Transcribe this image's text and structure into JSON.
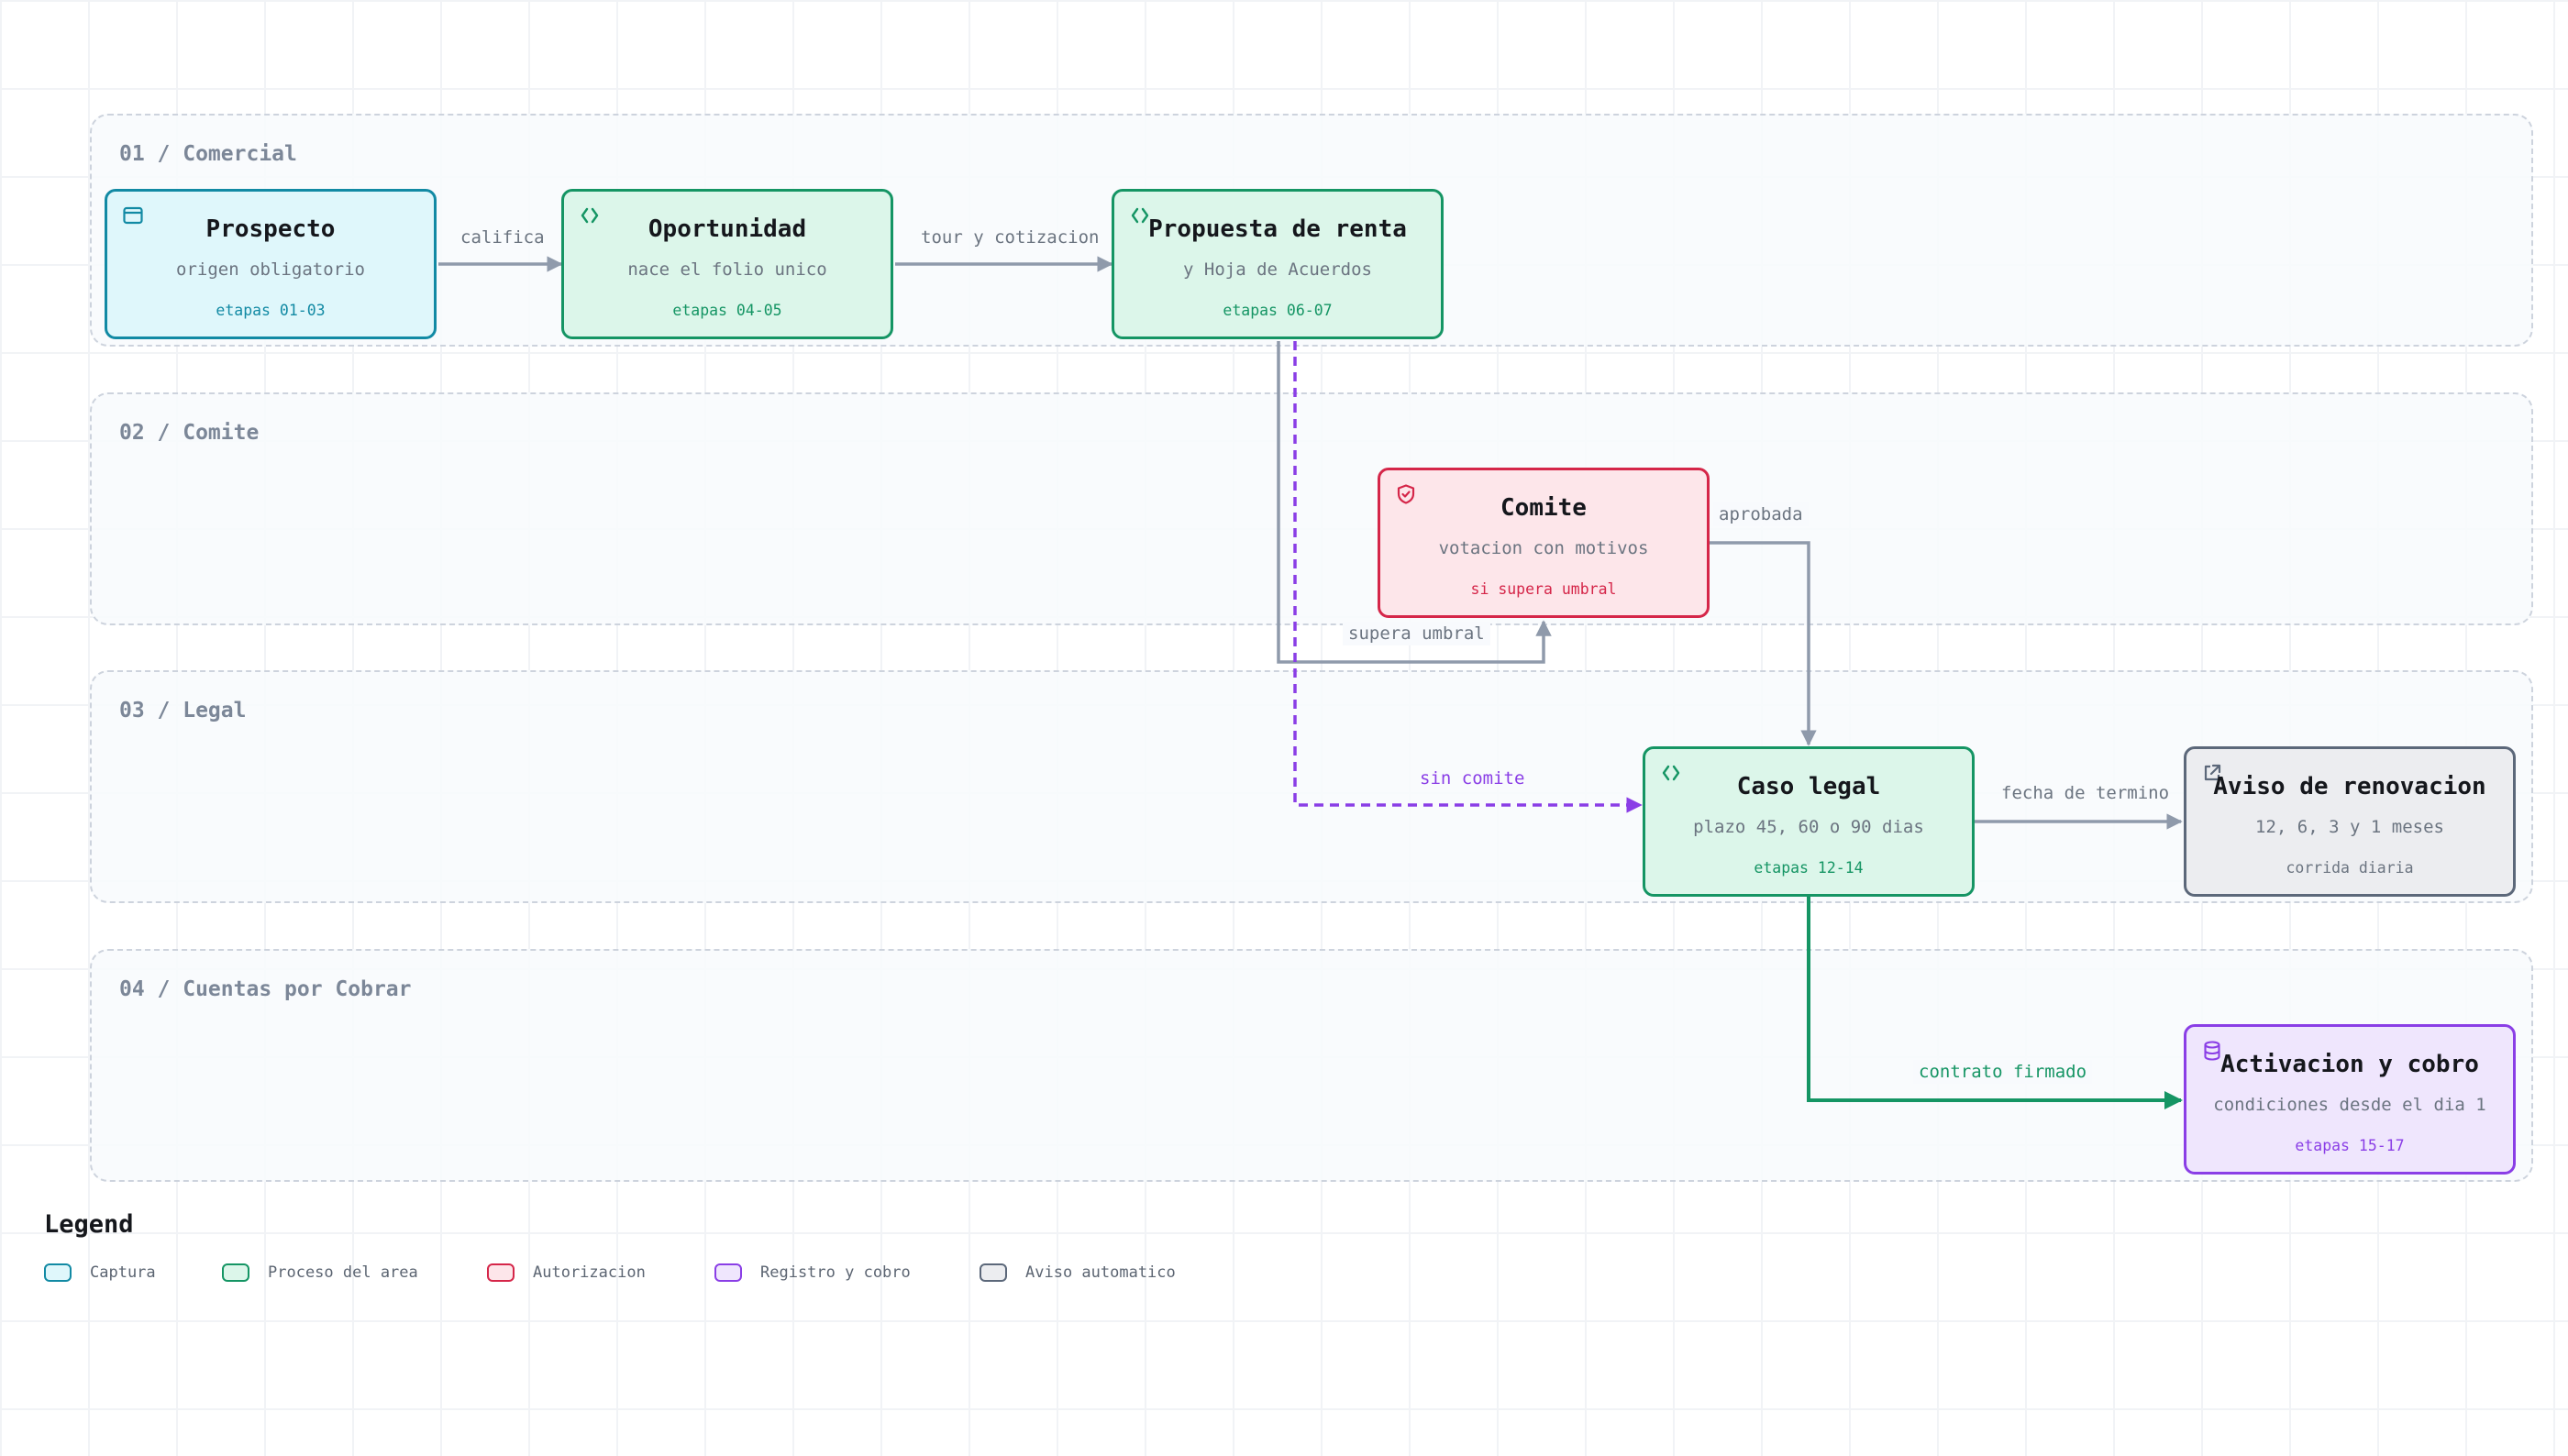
{
  "lanes": [
    {
      "label": "01 / Comercial"
    },
    {
      "label": "02 / Comite"
    },
    {
      "label": "03 / Legal"
    },
    {
      "label": "04 / Cuentas por Cobrar"
    }
  ],
  "nodes": {
    "prospecto": {
      "title": "Prospecto",
      "subtitle": "origen obligatorio",
      "meta": "etapas 01-03",
      "icon": "browser-window-icon"
    },
    "oportunidad": {
      "title": "Oportunidad",
      "subtitle": "nace el folio unico",
      "meta": "etapas 04-05",
      "icon": "code-brackets-icon"
    },
    "propuesta": {
      "title": "Propuesta de renta",
      "subtitle": "y Hoja de Acuerdos",
      "meta": "etapas 06-07",
      "icon": "code-brackets-icon"
    },
    "comite": {
      "title": "Comite",
      "subtitle": "votacion con motivos",
      "meta": "si supera umbral",
      "icon": "shield-check-icon"
    },
    "caso_legal": {
      "title": "Caso legal",
      "subtitle": "plazo 45, 60 o 90 dias",
      "meta": "etapas 12-14",
      "icon": "code-brackets-icon"
    },
    "aviso": {
      "title": "Aviso de renovacion",
      "subtitle": "12, 6, 3 y 1 meses",
      "meta": "corrida diaria",
      "icon": "external-link-icon"
    },
    "activacion": {
      "title": "Activacion y cobro",
      "subtitle": "condiciones desde el dia 1",
      "meta": "etapas 15-17",
      "icon": "database-icon"
    }
  },
  "edges": {
    "califica": "califica",
    "tour": "tour y cotizacion",
    "supera": "supera umbral",
    "aprobada": "aprobada",
    "sin_comite": "sin comite",
    "fecha": "fecha de termino",
    "contrato": "contrato firmado"
  },
  "legend": {
    "title": "Legend",
    "items": [
      "Captura",
      "Proceso del area",
      "Autorizacion",
      "Registro y cobro",
      "Aviso automatico"
    ]
  },
  "colors": {
    "captura": "#128aa4",
    "proceso": "#159564",
    "autorizacion": "#d52649",
    "registro": "#8a3ee6",
    "aviso": "#5c687a",
    "edge": "#8f9aab"
  }
}
